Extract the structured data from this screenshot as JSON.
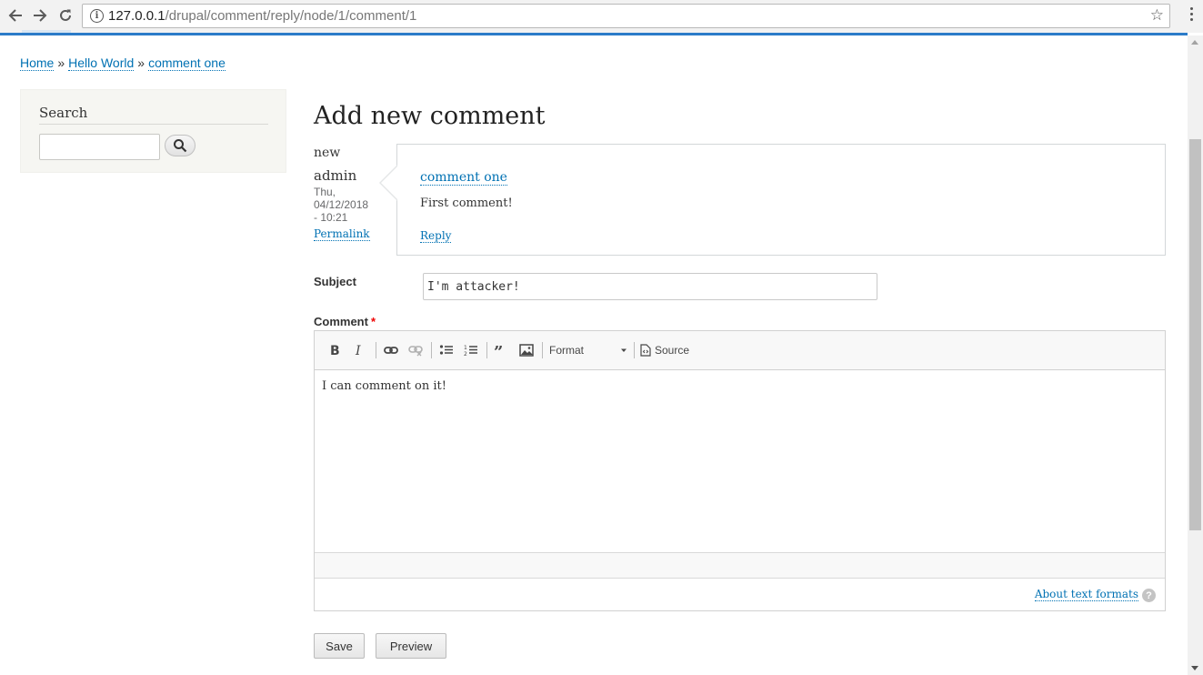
{
  "browser": {
    "url_host": "127.0.0.1",
    "url_path": "/drupal/comment/reply/node/1/comment/1",
    "back_icon": "arrow-left",
    "forward_icon": "arrow-right",
    "reload_icon": "reload",
    "info_icon": "i",
    "bookmark_icon": "star"
  },
  "breadcrumb": {
    "items": [
      "Home",
      "Hello World",
      "comment one"
    ],
    "separator": "»"
  },
  "sidebar": {
    "search_title": "Search",
    "search_value": ""
  },
  "page": {
    "title": "Add new comment"
  },
  "comment": {
    "new_marker": "new",
    "author": "admin",
    "date": "Thu, 04/12/2018 - 10:21",
    "permalink": "Permalink",
    "title": "comment one",
    "body": "First comment!",
    "reply": "Reply"
  },
  "form": {
    "subject_label": "Subject",
    "subject_value": "I'm attacker!",
    "comment_label": "Comment",
    "required_mark": "*",
    "comment_text": "I can comment on it!",
    "format_label": "Format",
    "source_label": "Source",
    "about_formats": "About text formats",
    "help_icon": "?",
    "save_label": "Save",
    "preview_label": "Preview",
    "toolbar_icons": [
      "bold-icon",
      "italic-icon",
      "link-icon",
      "unlink-icon",
      "bulleted-list-icon",
      "numbered-list-icon",
      "blockquote-icon",
      "image-icon",
      "source-icon"
    ]
  }
}
